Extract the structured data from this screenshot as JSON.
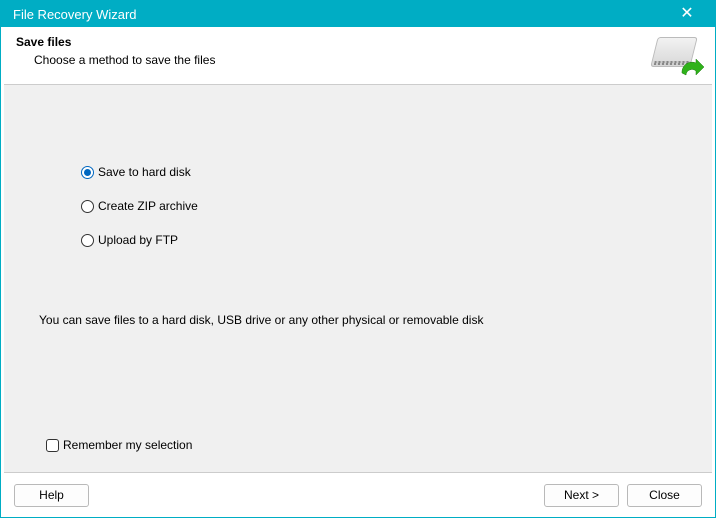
{
  "window": {
    "title": "File Recovery Wizard"
  },
  "header": {
    "heading": "Save files",
    "sub": "Choose a method to save the files"
  },
  "options": [
    {
      "label": "Save to hard disk",
      "selected": true
    },
    {
      "label": "Create ZIP archive",
      "selected": false
    },
    {
      "label": "Upload by FTP",
      "selected": false
    }
  ],
  "description": "You can save files to a hard disk, USB drive or any other physical or removable disk",
  "remember": {
    "label": "Remember my selection",
    "checked": false
  },
  "buttons": {
    "help": "Help",
    "next": "Next >",
    "close": "Close"
  }
}
